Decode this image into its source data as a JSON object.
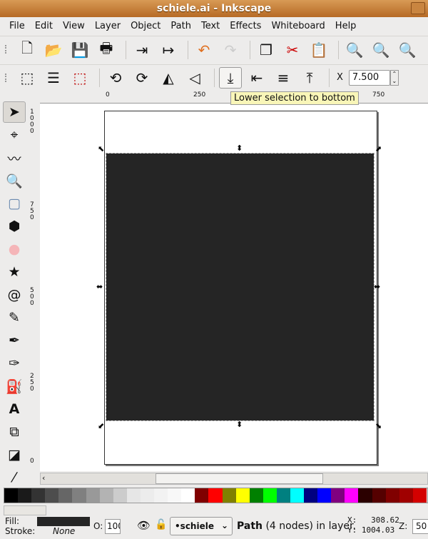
{
  "window": {
    "title": "schiele.ai - Inkscape"
  },
  "menu": [
    "File",
    "Edit",
    "View",
    "Layer",
    "Object",
    "Path",
    "Text",
    "Effects",
    "Whiteboard",
    "Help"
  ],
  "toolbar_icons": [
    "new-document-icon",
    "open-icon",
    "save-icon",
    "print-icon",
    "import-icon",
    "export-icon",
    "undo-icon",
    "redo-icon",
    "duplicate-icon",
    "cut-icon",
    "paste-icon",
    "zoom-selection-icon",
    "zoom-drawing-icon",
    "zoom-page-icon"
  ],
  "select_toolbar": {
    "x_label": "X",
    "x_value": "7.500",
    "tooltip": "Lower selection to bottom"
  },
  "ruler": {
    "top": [
      "0",
      "250",
      "750"
    ],
    "left": [
      "1000",
      "750",
      "500",
      "250",
      "0"
    ]
  },
  "tools": [
    "selector",
    "node",
    "tweak",
    "zoom",
    "rectangle",
    "3d-box",
    "ellipse",
    "star",
    "spiral",
    "pencil",
    "pen",
    "calligraphy",
    "paint-bucket",
    "text",
    "connector",
    "gradient",
    "dropper"
  ],
  "palette": [
    "#000000",
    "#1a1a1a",
    "#333333",
    "#4d4d4d",
    "#666666",
    "#808080",
    "#999999",
    "#b3b3b3",
    "#cccccc",
    "#e6e6e6",
    "#ececec",
    "#f2f2f2",
    "#f8f8f8",
    "#ffffff",
    "#800000",
    "#ff0000",
    "#808000",
    "#ffff00",
    "#008000",
    "#00ff00",
    "#008080",
    "#00ffff",
    "#000080",
    "#0000ff",
    "#800080",
    "#ff00ff",
    "#2b0000",
    "#550000",
    "#800000",
    "#a00000",
    "#d40000"
  ],
  "status": {
    "fill_label": "Fill:",
    "stroke_label": "Stroke:",
    "stroke_value": "None",
    "fill_color": "#252525",
    "opacity_label": "O:",
    "opacity_value": "100",
    "layer": "•schiele",
    "message_bold": "Path",
    "message": " (4 nodes) in layer.",
    "x": "X:   308.62",
    "y": "Y: 1004.03",
    "zoom_label": "Z:",
    "zoom_value": "50"
  }
}
